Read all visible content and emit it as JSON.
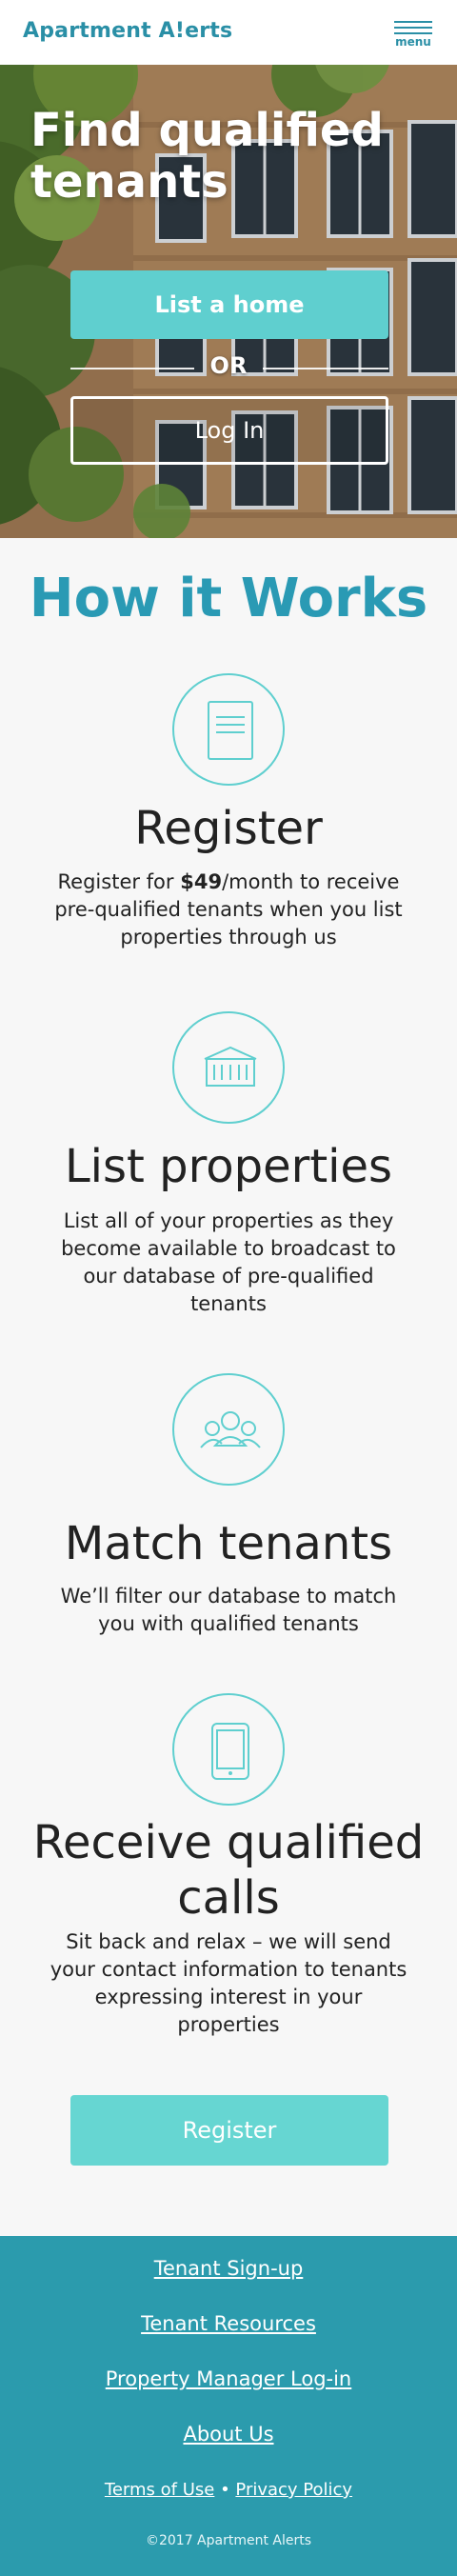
{
  "header": {
    "brand": "Apartment A!erts",
    "menu_label": "menu"
  },
  "hero": {
    "title": "Find qualified tenants",
    "list_button": "List a home",
    "or_text": "OR",
    "login_button": "Log In"
  },
  "how": {
    "title": "How it Works",
    "steps": [
      {
        "title": "Register",
        "desc_pre": "Register for ",
        "desc_bold": "$49",
        "desc_post": "/month to receive pre-qualified tenants when you list properties through us",
        "icon": "document-icon"
      },
      {
        "title": "List properties",
        "desc": "List all of your properties as they become available to broadcast to our database of pre-qualified tenants",
        "icon": "building-icon"
      },
      {
        "title": "Match tenants",
        "desc": "We’ll filter our database to match you with qualified tenants",
        "icon": "people-icon"
      },
      {
        "title": "Receive qualified calls",
        "desc": "Sit back and relax – we will send your contact information to tenants expressing interest in your properties",
        "icon": "phone-icon"
      }
    ],
    "register_button": "Register"
  },
  "footer": {
    "links": [
      "Tenant Sign-up",
      "Tenant Resources",
      "Property Manager Log-in",
      "About Us"
    ],
    "terms": "Terms of Use",
    "separator": " • ",
    "privacy": "Privacy Policy",
    "copyright": "©2017 Apartment Alerts"
  },
  "colors": {
    "brand": "#2a8fa6",
    "accent": "#5fcfcf",
    "footer_bg": "#2b9bad"
  }
}
